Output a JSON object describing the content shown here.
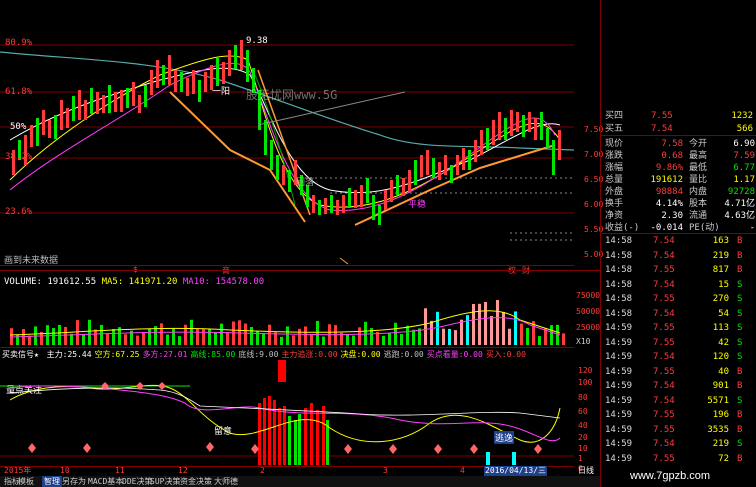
{
  "main_chart": {
    "levels": [
      "80.9%",
      "61.8%",
      "50%",
      "38.2%",
      "23.6%"
    ],
    "level_top": "9.38",
    "label_mid": "一阳",
    "label_low": "回落",
    "label_low2": "平稳",
    "watermark": "股无忧网www.5G",
    "link_text": "画到未来数据",
    "price_axis": [
      "7.50",
      "7.00",
      "6.50",
      "6.00",
      "5.50",
      "5.00"
    ],
    "event_markers": [
      "$",
      "商",
      "权",
      "财"
    ]
  },
  "volume": {
    "header_label": "VOLUME:",
    "volume_value": "191612.55",
    "ma5_label": "MA5:",
    "ma5_value": "141971.20",
    "ma10_label": "MA10:",
    "ma10_value": "154578.00",
    "axis": [
      "75000",
      "50000",
      "25000"
    ],
    "axis_unit": "X10"
  },
  "indicator": {
    "name": "买卖信号★",
    "items": [
      {
        "label": "主力:",
        "value": "25.44",
        "color": "#ffffff"
      },
      {
        "label": "空方:",
        "value": "67.25",
        "color": "#ffff00"
      },
      {
        "label": "多方:",
        "value": "27.01",
        "color": "#ff40ff"
      },
      {
        "label": "高线:",
        "value": "85.00",
        "color": "#00e600"
      },
      {
        "label": "底线:",
        "value": "9.00",
        "color": "#c0c0c0"
      },
      {
        "label": "主力追涨:",
        "value": "0.00",
        "color": "#ff3b3b"
      },
      {
        "label": "决盘:",
        "value": "0.00",
        "color": "#ffff00"
      },
      {
        "label": "逃跑:",
        "value": "0.00",
        "color": "#c0c0c0"
      },
      {
        "label": "买点看量:",
        "value": "0.00",
        "color": "#ff40ff"
      },
      {
        "label": "买入:",
        "value": "0.00",
        "color": "#ff3b3b"
      }
    ],
    "subtitle": "量点关注",
    "axis": [
      "120",
      "100",
      "80",
      "60",
      "40",
      "20",
      "10",
      "1",
      "0"
    ],
    "tag_left": "留意",
    "tag_right": "逃逸"
  },
  "date_axis": {
    "labels": [
      "2015年",
      "10",
      "11",
      "12",
      "2",
      "3",
      "4"
    ],
    "cursor_date": "2016/04/13/三",
    "period": "日线"
  },
  "tabs": [
    "指标",
    "模板",
    "智理",
    "另存为",
    "MACD基本",
    "DDE决策",
    "SUP决策",
    "资金决策",
    "大师德"
  ],
  "active_tab": 2,
  "quote": {
    "asks": [
      {
        "label": "买四",
        "price": "7.55",
        "vol": "1232"
      },
      {
        "label": "买五",
        "price": "7.54",
        "vol": "566"
      }
    ],
    "rows": [
      {
        "l1": "现价",
        "v1": "7.58",
        "c1": "#ff3b3b",
        "l2": "今开",
        "v2": "6.90",
        "c2": "#ffffff"
      },
      {
        "l1": "涨跌",
        "v1": "0.68",
        "c1": "#ff3b3b",
        "l2": "最高",
        "v2": "7.59",
        "c2": "#ff3b3b"
      },
      {
        "l1": "涨幅",
        "v1": "9.86%",
        "c1": "#ff3b3b",
        "l2": "最低",
        "v2": "6.77",
        "c2": "#00e600"
      },
      {
        "l1": "总量",
        "v1": "191612",
        "c1": "#ffff00",
        "l2": "量比",
        "v2": "1.17",
        "c2": "#ffff00"
      },
      {
        "l1": "外盘",
        "v1": "98884",
        "c1": "#ff3b3b",
        "l2": "内盘",
        "v2": "92728",
        "c2": "#00e600"
      },
      {
        "l1": "换手",
        "v1": "4.14%",
        "c1": "#ffffff",
        "l2": "股本",
        "v2": "4.71亿",
        "c2": "#ffffff"
      },
      {
        "l1": "净资",
        "v1": "2.30",
        "c1": "#ffffff",
        "l2": "流通",
        "v2": "4.63亿",
        "c2": "#ffffff"
      },
      {
        "l1": "收益(-)",
        "v1": "-0.014",
        "c1": "#ffffff",
        "l2": "PE(动)",
        "v2": "-",
        "c2": "#ffffff"
      }
    ]
  },
  "ticks": [
    {
      "t": "14:58",
      "p": "7.54",
      "v": "163",
      "s": "B"
    },
    {
      "t": "14:58",
      "p": "7.54",
      "v": "219",
      "s": "B"
    },
    {
      "t": "14:58",
      "p": "7.55",
      "v": "817",
      "s": "B"
    },
    {
      "t": "14:58",
      "p": "7.54",
      "v": "15",
      "s": "S"
    },
    {
      "t": "14:58",
      "p": "7.55",
      "v": "270",
      "s": "S"
    },
    {
      "t": "14:58",
      "p": "7.54",
      "v": "54",
      "s": "S"
    },
    {
      "t": "14:59",
      "p": "7.55",
      "v": "113",
      "s": "S"
    },
    {
      "t": "14:59",
      "p": "7.55",
      "v": "42",
      "s": "S"
    },
    {
      "t": "14:59",
      "p": "7.54",
      "v": "120",
      "s": "S"
    },
    {
      "t": "14:59",
      "p": "7.55",
      "v": "40",
      "s": "B"
    },
    {
      "t": "14:59",
      "p": "7.54",
      "v": "901",
      "s": "B"
    },
    {
      "t": "14:59",
      "p": "7.54",
      "v": "5571",
      "s": "S"
    },
    {
      "t": "14:59",
      "p": "7.55",
      "v": "196",
      "s": "B"
    },
    {
      "t": "14:59",
      "p": "7.55",
      "v": "3535",
      "s": "B"
    },
    {
      "t": "14:59",
      "p": "7.54",
      "v": "219",
      "s": "S"
    },
    {
      "t": "14:59",
      "p": "7.55",
      "v": "72",
      "s": "B"
    }
  ],
  "footer_site": "www.7gpzb.com"
}
